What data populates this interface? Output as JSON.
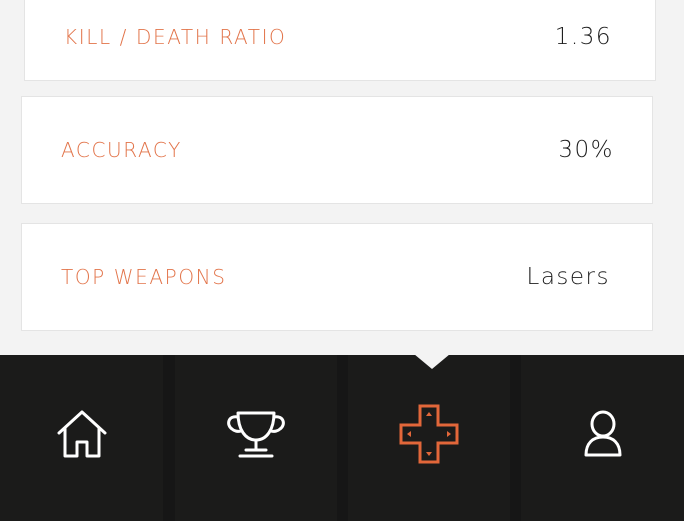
{
  "stats": [
    {
      "label": "KILL / DEATH RATIO",
      "value": "1.36"
    },
    {
      "label": "ACCURACY",
      "value": "30%"
    },
    {
      "label": "TOP WEAPONS",
      "value": "Lasers"
    }
  ],
  "tabbar": {
    "items": [
      {
        "icon": "home-icon",
        "active": false
      },
      {
        "icon": "trophy-icon",
        "active": false
      },
      {
        "icon": "gamepad-cross-icon",
        "active": true
      },
      {
        "icon": "user-icon",
        "active": false
      }
    ]
  },
  "colors": {
    "accent": "#e2673a",
    "label": "#e2744a",
    "tabbar_bg": "#1b1b1a",
    "icon_inactive": "#ffffff",
    "page_bg": "#f3f3f3"
  }
}
